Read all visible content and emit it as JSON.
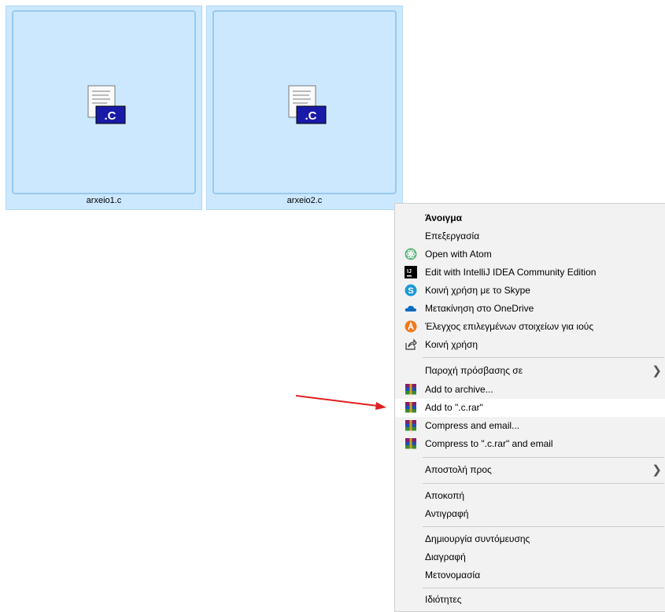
{
  "files": [
    {
      "name": "arxeio1.c",
      "badge": ".C"
    },
    {
      "name": "arxeio2.c",
      "badge": ".C"
    }
  ],
  "menu": {
    "items": [
      {
        "label": "Άνοιγμα",
        "icon": ""
      },
      {
        "label": "Επεξεργασία",
        "icon": ""
      },
      {
        "label": "Open with Atom",
        "icon": "atom-icon"
      },
      {
        "label": "Edit with IntelliJ IDEA Community Edition",
        "icon": "intellij-icon"
      },
      {
        "label": "Κοινή χρήση με το Skype",
        "icon": "skype-icon"
      },
      {
        "label": "Μετακίνηση στο OneDrive",
        "icon": "onedrive-icon"
      },
      {
        "label": "Έλεγχος επιλεγμένων στοιχείων για ιούς",
        "icon": "avast-icon"
      },
      {
        "label": "Κοινή χρήση",
        "icon": "share-icon"
      },
      {
        "label": "Παροχή πρόσβασης σε",
        "icon": ""
      },
      {
        "label": "Add to archive...",
        "icon": "winrar-icon"
      },
      {
        "label": "Add to \".c.rar\"",
        "icon": "winrar-icon"
      },
      {
        "label": "Compress and email...",
        "icon": "winrar-icon"
      },
      {
        "label": "Compress to \".c.rar\" and email",
        "icon": "winrar-icon"
      },
      {
        "label": "Αποστολή προς",
        "icon": ""
      },
      {
        "label": "Αποκοπή",
        "icon": ""
      },
      {
        "label": "Αντιγραφή",
        "icon": ""
      },
      {
        "label": "Δημιουργία συντόμευσης",
        "icon": ""
      },
      {
        "label": "Διαγραφή",
        "icon": ""
      },
      {
        "label": "Μετονομασία",
        "icon": ""
      },
      {
        "label": "Ιδιότητες",
        "icon": ""
      }
    ]
  },
  "colors": {
    "selection": "#cce8ff",
    "menu_bg": "#f2f2f2",
    "hover": "#ffffff",
    "annotation_arrow": "#e02020"
  }
}
